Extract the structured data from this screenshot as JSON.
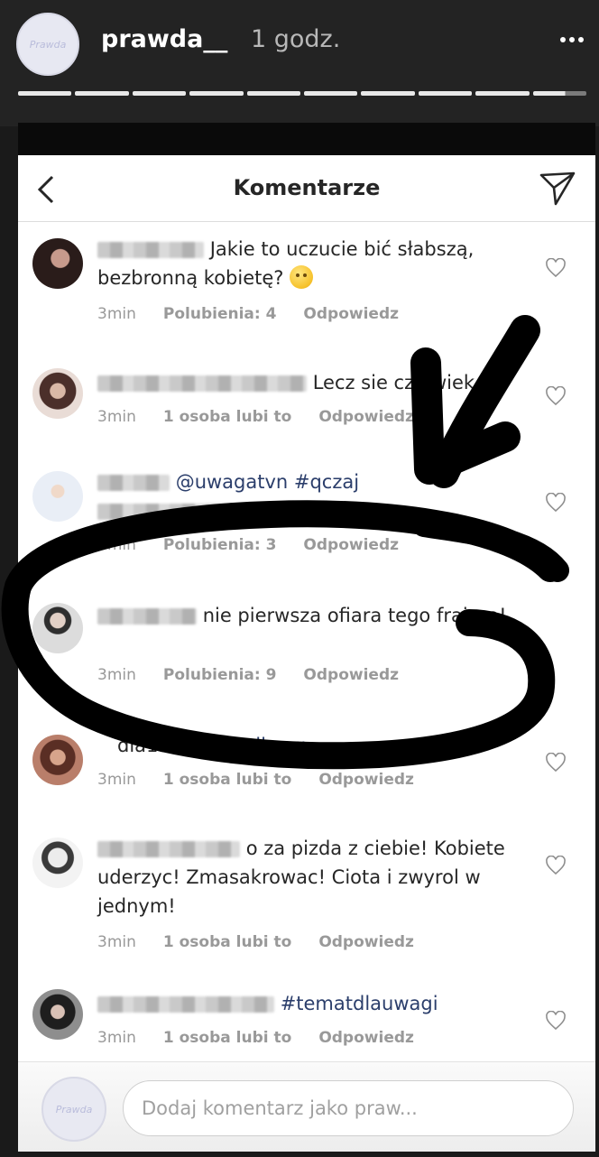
{
  "story": {
    "avatar_text": "Prawda",
    "username": "prawda__",
    "time": "1 godz.",
    "progress_segments": [
      1,
      1,
      1,
      1,
      1,
      1,
      1,
      1,
      1,
      0.6
    ]
  },
  "nav": {
    "title": "Komentarze"
  },
  "comments": [
    {
      "text": "Jakie to uczucie bić słabszą, bezbronną kobietę?",
      "time": "3min",
      "likes": "Polubienia: 4",
      "reply": "Odpowiedz"
    },
    {
      "text": "Lecz sie człowiek",
      "time": "3min",
      "likes": "1 osoba lubi to",
      "reply": "Odpowiedz"
    },
    {
      "text_tags": "@uwagatvn #qczaj",
      "time": "3min",
      "likes": "Polubienia: 3",
      "reply": "Odpowiedz"
    },
    {
      "text": "nie pierwsza  ofiara tego frajera!",
      "time": "3min",
      "likes": "Polubienia: 9",
      "reply": "Odpowiedz"
    },
    {
      "username_part": "dia15",
      "text_tags": "#tematdlauw",
      "time": "3min",
      "likes": "1 osoba lubi to",
      "reply": "Odpowiedz"
    },
    {
      "text": "o za pizda z ciebie! Kobiete uderzyc! Zmasakrowac! Ciota i zwyrol w jednym!",
      "time": "3min",
      "likes": "1 osoba lubi to",
      "reply": "Odpowiedz"
    },
    {
      "text_tags": "#tematdlauwagi",
      "time": "3min",
      "likes": "1 osoba lubi to",
      "reply": "Odpowiedz"
    }
  ],
  "composer": {
    "avatar_text": "Prawda",
    "placeholder": "Dodaj komentarz jako praw..."
  },
  "colors": {
    "story_bg": "#232323",
    "marker": "#000000",
    "tag": "#2b3e6b"
  }
}
